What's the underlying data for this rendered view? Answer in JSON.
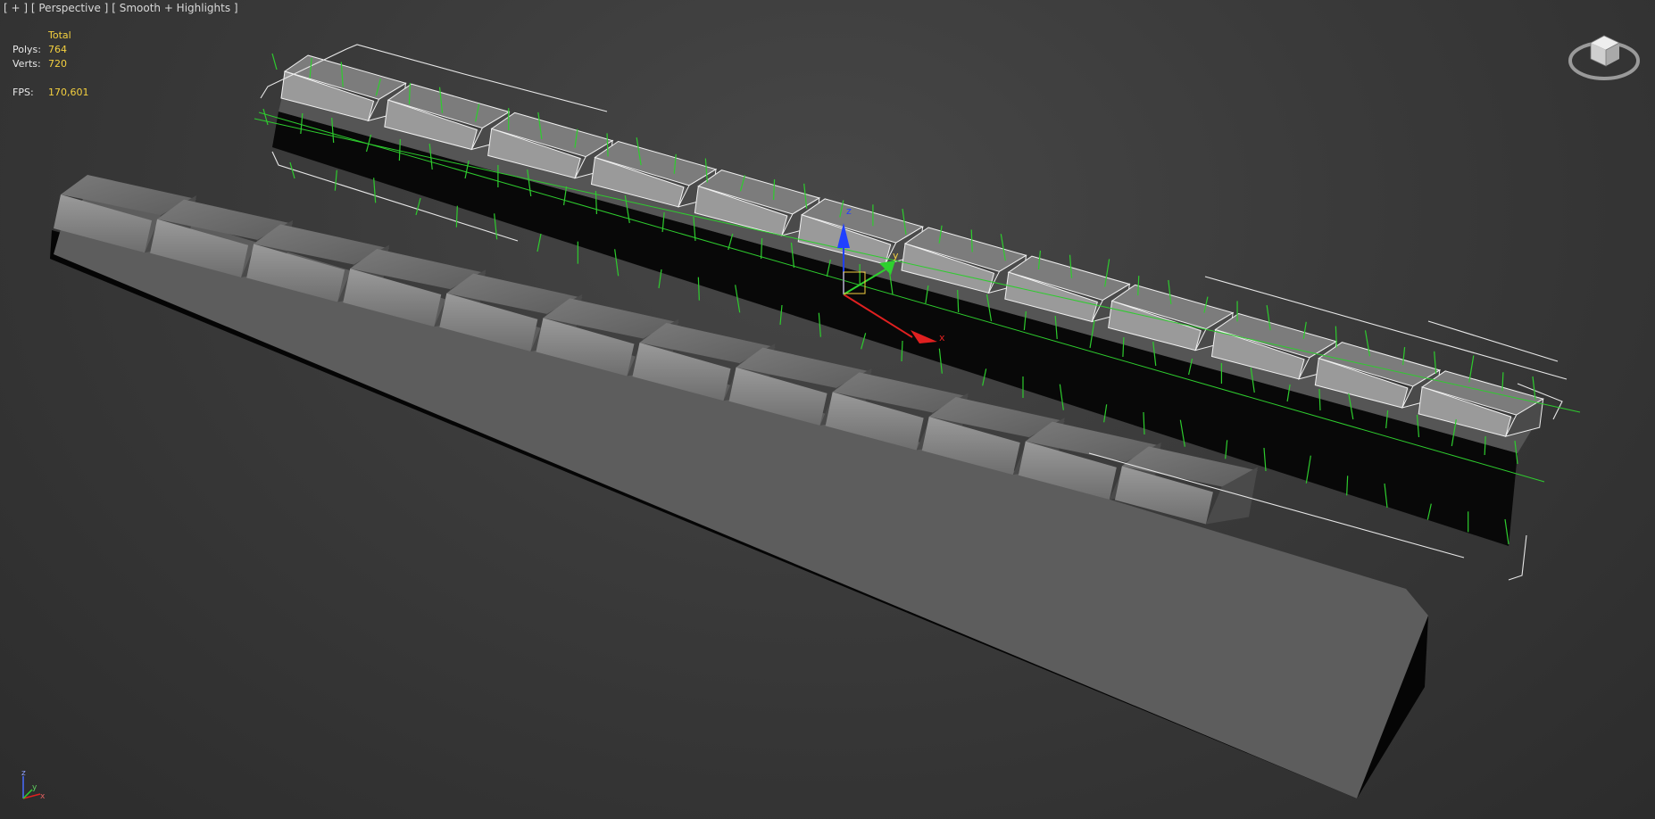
{
  "viewport": {
    "menu_plus": "[ + ]",
    "menu_view": "[ Perspective ]",
    "menu_shading": "[ Smooth + Highlights ]"
  },
  "stats": {
    "header": "Total",
    "polys_label": "Polys:",
    "polys_value": "764",
    "verts_label": "Verts:",
    "verts_value": "720",
    "fps_label": "FPS:",
    "fps_value": "170,601"
  },
  "gizmo": {
    "x": "x",
    "y": "y",
    "z": "z"
  },
  "axis_tripod": {
    "x": "x",
    "y": "y",
    "z": "z"
  },
  "colors": {
    "background": "#3a3a3a",
    "normals": "#2ecc2e",
    "selection_box": "#ffffff",
    "x_axis": "#e02020",
    "y_axis": "#2ed12e",
    "z_axis": "#2040ff",
    "stat_values": "#f4d03f"
  },
  "icons": [
    "viewcube-icon",
    "transform-gizmo-icon",
    "axis-tripod-icon"
  ]
}
